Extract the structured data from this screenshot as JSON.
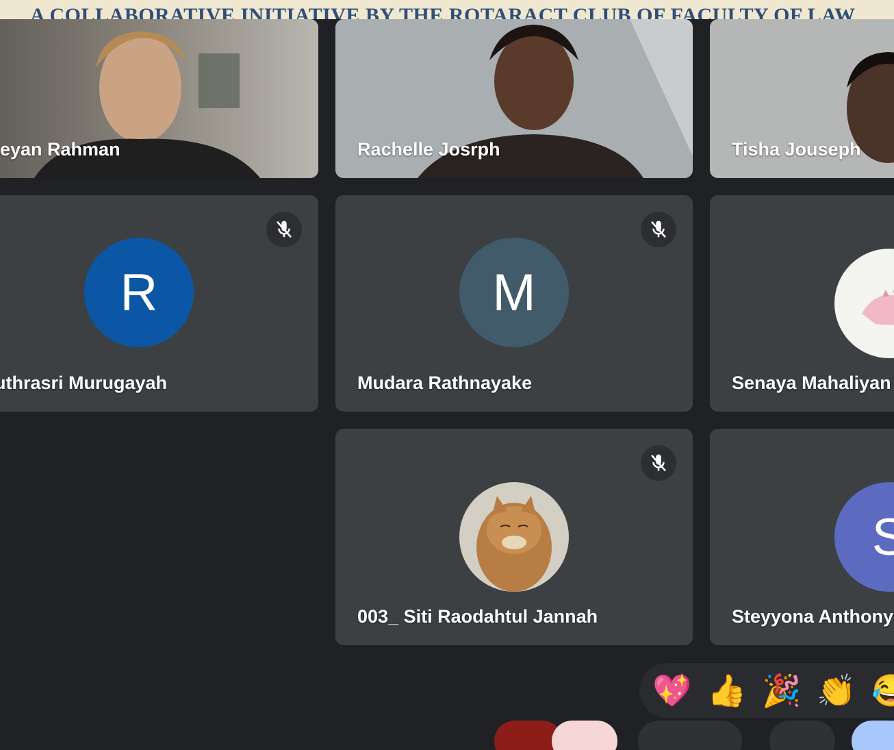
{
  "banner": {
    "text": "A COLLABORATIVE INITIATIVE BY THE ROTARACT CLUB OF FACULTY OF LAW"
  },
  "participants": [
    {
      "name": "eyan Rahman",
      "type": "video",
      "muted": false
    },
    {
      "name": "Rachelle Josrph",
      "type": "video",
      "muted": false
    },
    {
      "name": "Tisha Jouseph",
      "type": "video",
      "muted": false
    },
    {
      "name": "uthrasri Murugayah",
      "type": "avatar",
      "initial": "R",
      "avatar_color": "#0b57a5",
      "muted": true
    },
    {
      "name": "Mudara Rathnayake",
      "type": "avatar",
      "initial": "M",
      "avatar_color": "#425b6b",
      "muted": true
    },
    {
      "name": "Senaya Mahaliyan",
      "type": "picture",
      "muted": false
    },
    {
      "name": "003_ Siti Raodahtul Jannah",
      "type": "picture",
      "muted": true
    },
    {
      "name": "Steyyona Anthony",
      "type": "avatar",
      "initial": "S",
      "avatar_color": "#5c6bc0",
      "muted": false
    }
  ],
  "reactions": [
    "💖",
    "👍",
    "🎉",
    "👏",
    "😂"
  ],
  "icons": {
    "mute": "mic-off-icon"
  },
  "colors": {
    "background": "#202124",
    "tile": "#3c4043",
    "banner": "#efe7d0",
    "banner_text": "#2f4f7a"
  }
}
